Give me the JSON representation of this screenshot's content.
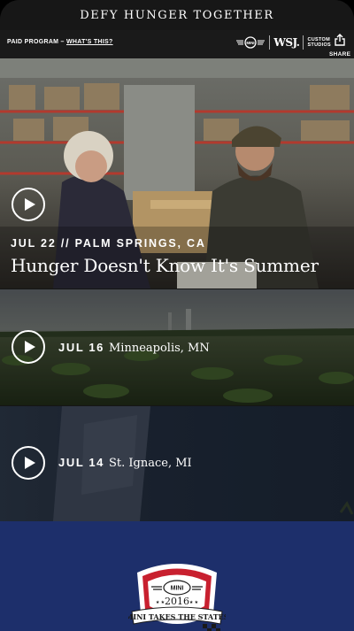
{
  "header": {
    "title": "DEFY HUNGER TOGETHER"
  },
  "sponsor": {
    "paid_label": "PAID PROGRAM –",
    "whats_this": "WHAT'S THIS?",
    "mini_logo_text": "MINI",
    "wsj_logo": "WSJ.",
    "custom_studios_line1": "CUSTOM",
    "custom_studios_line2": "STUDIOS",
    "share_label": "SHARE"
  },
  "featured": {
    "date_location": "JUL 22 // PALM SPRINGS, CA",
    "title": "Hunger Doesn't Know It's Summer"
  },
  "videos": [
    {
      "date": "JUL 16",
      "place": "Minneapolis, MN"
    },
    {
      "date": "JUL 14",
      "place": "St. Ignace, MI"
    }
  ],
  "badge": {
    "brand": "MINI",
    "year": "2016",
    "banner": "MINI TAKES THE STATES"
  },
  "colors": {
    "band_blue": "#1d2f6b",
    "badge_red": "#c8202f"
  }
}
